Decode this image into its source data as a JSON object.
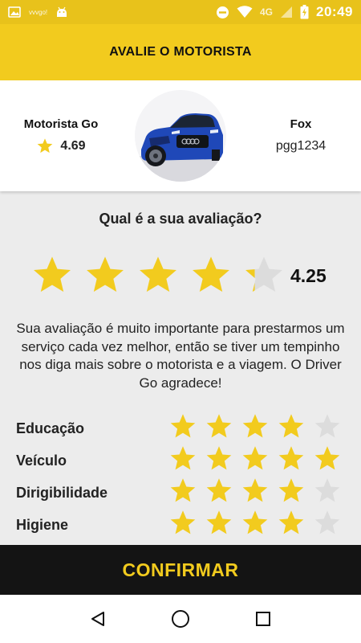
{
  "status_bar": {
    "time": "20:49",
    "network": "4G",
    "notification_text": "vvvgo!",
    "icons": [
      "gallery-icon",
      "app-notification-icon",
      "android-icon",
      "do-not-disturb-icon",
      "wifi-icon",
      "signal-icon",
      "battery-charging-icon"
    ]
  },
  "header": {
    "title": "AVALIE O MOTORISTA"
  },
  "driver": {
    "name": "Motorista Go",
    "rating": "4.69",
    "rating_icon": "star-icon",
    "photo_icon": "car-photo",
    "car_model": "Fox",
    "car_plate": "pgg1234"
  },
  "rating": {
    "question": "Qual é a sua avaliação?",
    "value": 4.25,
    "value_label": "4.25",
    "max": 5
  },
  "message": "Sua avaliação é muito importante para prestarmos um serviço cada vez melhor, então se tiver um tempinho nos diga mais sobre o motorista e a viagem. O Driver Go agradece!",
  "criteria": [
    {
      "label": "Educação",
      "value": 4,
      "max": 5
    },
    {
      "label": "Veículo",
      "value": 5,
      "max": 5
    },
    {
      "label": "Dirigibilidade",
      "value": 4,
      "max": 5
    },
    {
      "label": "Higiene",
      "value": 4,
      "max": 5
    }
  ],
  "confirm_label": "CONFIRMAR",
  "nav": {
    "icons": [
      "back-icon",
      "home-icon",
      "recents-icon"
    ]
  },
  "colors": {
    "accent": "#f2cb1e",
    "star_filled": "#f2cb1e",
    "star_empty": "#dcdcdc",
    "confirm_bg": "#141414"
  }
}
